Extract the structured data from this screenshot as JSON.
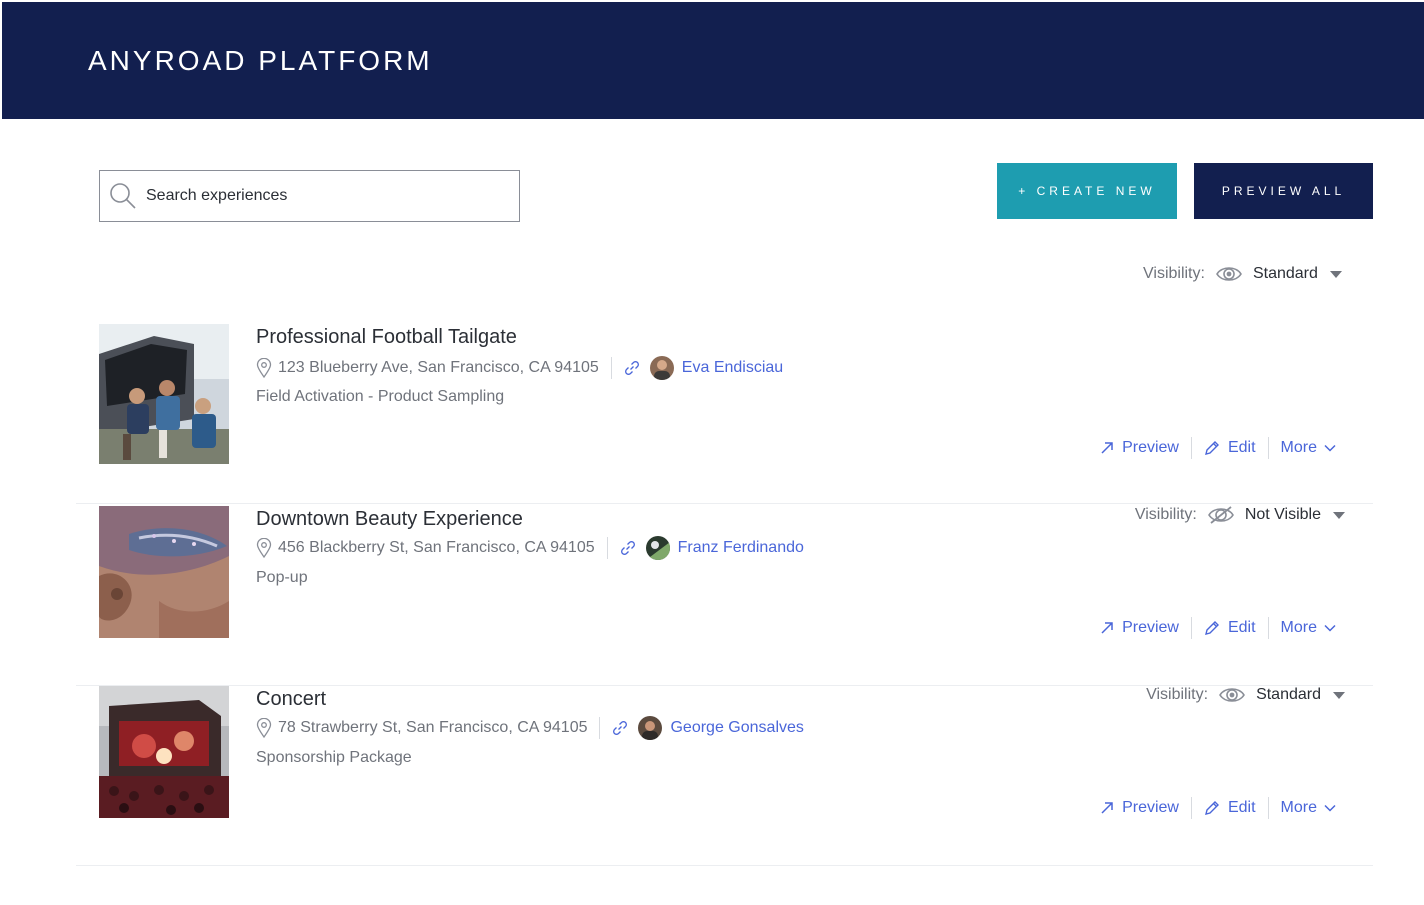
{
  "header": {
    "brand": "ANYROAD PLATFORM"
  },
  "search": {
    "placeholder": "Search experiences"
  },
  "toolbar": {
    "create_label": "+ CREATE NEW",
    "preview_all_label": "PREVIEW ALL"
  },
  "global_visibility": {
    "label": "Visibility:",
    "value": "Standard",
    "icon": "eye-icon"
  },
  "experiences": [
    {
      "title": "Professional Football Tailgate",
      "address": "123 Blueberry Ave, San Francisco, CA 94105",
      "host": "Eva Endisciau",
      "category": "Field Activation - Product Sampling",
      "visibility": null,
      "actions": {
        "preview": "Preview",
        "edit": "Edit",
        "more": "More"
      }
    },
    {
      "title": "Downtown Beauty Experience",
      "address": "456 Blackberry St, San Francisco, CA 94105",
      "host": "Franz Ferdinando",
      "category": "Pop-up",
      "visibility": {
        "label": "Visibility:",
        "value": "Not Visible",
        "icon": "eye-slash-icon"
      },
      "actions": {
        "preview": "Preview",
        "edit": "Edit",
        "more": "More"
      }
    },
    {
      "title": "Concert",
      "address": "78 Strawberry St, San Francisco, CA 94105",
      "host": "George Gonsalves",
      "category": "Sponsorship Package",
      "visibility": {
        "label": "Visibility:",
        "value": "Standard",
        "icon": "eye-icon"
      },
      "actions": {
        "preview": "Preview",
        "edit": "Edit",
        "more": "More"
      }
    }
  ],
  "colors": {
    "header_bg": "#121f4f",
    "create_bg": "#1e9db0",
    "link": "#4a66d9",
    "muted": "#6f737b"
  }
}
